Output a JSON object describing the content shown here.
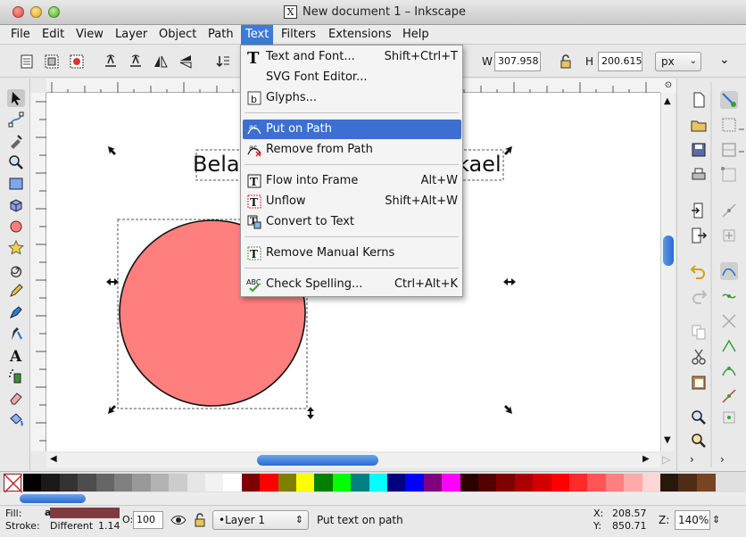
{
  "window": {
    "title": "New document 1 – Inkscape",
    "icon_glyph": "X"
  },
  "menubar": {
    "items": [
      {
        "label": "File"
      },
      {
        "label": "Edit"
      },
      {
        "label": "View"
      },
      {
        "label": "Layer"
      },
      {
        "label": "Object"
      },
      {
        "label": "Path"
      },
      {
        "label": "Text"
      },
      {
        "label": "Filters"
      },
      {
        "label": "Extensions"
      },
      {
        "label": "Help"
      }
    ],
    "active": "Text"
  },
  "toolbar": {
    "w_label": "W",
    "w_value": "307.958",
    "h_label": "H",
    "h_value": "200.615",
    "unit": "px"
  },
  "text_menu": {
    "items": [
      {
        "label": "Text and Font...",
        "accel": "Shift+Ctrl+T"
      },
      {
        "label": "SVG Font Editor...",
        "accel": ""
      },
      {
        "label": "Glyphs...",
        "accel": ""
      },
      {
        "label": "Put on Path",
        "accel": ""
      },
      {
        "label": "Remove from Path",
        "accel": ""
      },
      {
        "label": "Flow into Frame",
        "accel": "Alt+W"
      },
      {
        "label": "Unflow",
        "accel": "Shift+Alt+W"
      },
      {
        "label": "Convert to Text",
        "accel": ""
      },
      {
        "label": "Remove Manual Kerns",
        "accel": ""
      },
      {
        "label": "Check Spelling...",
        "accel": "Ctrl+Alt+K"
      }
    ],
    "highlighted": "Put on Path"
  },
  "canvas": {
    "text_left": "Bela",
    "text_right": "kael",
    "circle_fill": "#ff7f7f"
  },
  "palette": {
    "colors": [
      "#000000",
      "#1a1a1a",
      "#333333",
      "#4d4d4d",
      "#666666",
      "#808080",
      "#999999",
      "#b3b3b3",
      "#cccccc",
      "#e6e6e6",
      "#f2f2f2",
      "#ffffff",
      "#800000",
      "#ff0000",
      "#808000",
      "#ffff00",
      "#008000",
      "#00ff00",
      "#008080",
      "#00ffff",
      "#000080",
      "#0000ff",
      "#800080",
      "#ff00ff",
      "#2b0000",
      "#550000",
      "#800000",
      "#aa0000",
      "#d40000",
      "#ff0000",
      "#ff2a2a",
      "#ff5555",
      "#ff8080",
      "#ffaaaa",
      "#ffd5d5",
      "#28170b",
      "#502d16",
      "#784421"
    ]
  },
  "status": {
    "fill_label": "Fill:",
    "fill_value": "a",
    "stroke_label": "Stroke:",
    "stroke_value": "Different",
    "stroke_width": "1.14",
    "opacity_label": "O:",
    "opacity_value": "100",
    "layer": "•Layer 1",
    "message": "Put text on path",
    "x_label": "X:",
    "x_value": "208.57",
    "y_label": "Y:",
    "y_value": "850.71",
    "zoom_label": "Z:",
    "zoom_value": "140%",
    "fill_color": "#7f3a40"
  }
}
